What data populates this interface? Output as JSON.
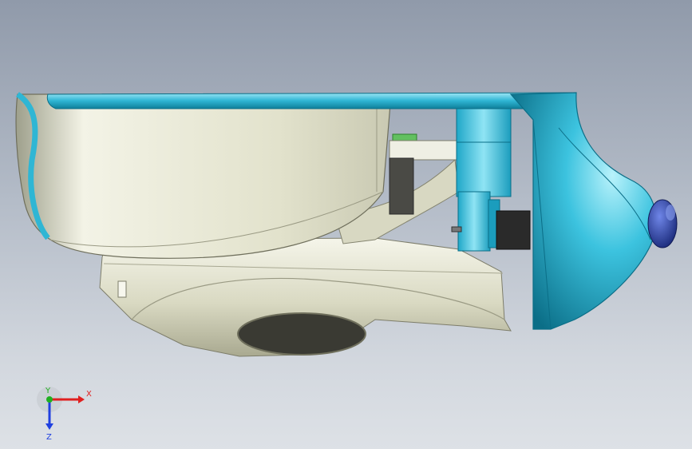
{
  "viewport": {
    "background_top": "#909aaa",
    "background_bottom": "#dde1e6"
  },
  "model": {
    "colors": {
      "shell": "#e6e6d2",
      "shell_shade": "#bdbda6",
      "accent": "#2fb6d4",
      "accent_dark": "#0e7f9a",
      "accent_light": "#9fe8f6",
      "motor": "#2a2a2a",
      "knob": "#2a3ea0",
      "pcb": "#62c060"
    }
  },
  "triad": {
    "x_label": "X",
    "y_label": "Y",
    "z_label": "Z",
    "x_color": "#e02020",
    "y_color": "#20b020",
    "z_color": "#2040e0"
  }
}
